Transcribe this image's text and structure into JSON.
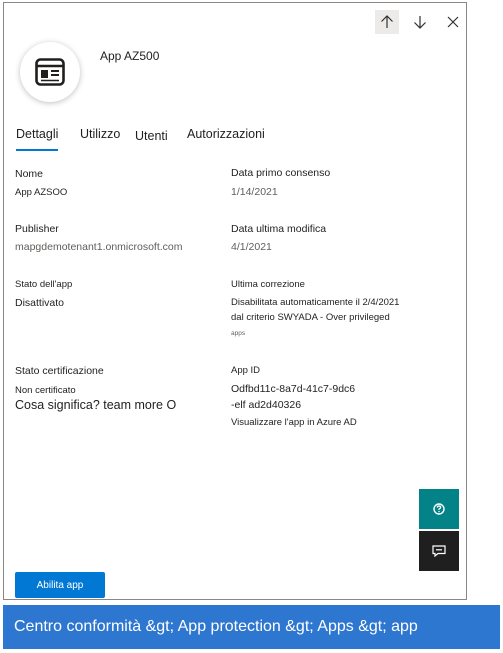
{
  "header": {
    "app_name": "App AZ500",
    "nav_up": "arrow-up-icon",
    "nav_down": "arrow-down-icon",
    "close": "close-icon"
  },
  "tabs": [
    {
      "label": "Dettagli",
      "selected": true
    },
    {
      "label": "Utilizzo",
      "selected": false
    },
    {
      "label": "Utenti",
      "selected": false
    },
    {
      "label": "Autorizzazioni",
      "selected": false
    }
  ],
  "details": {
    "name_label": "Nome",
    "name_value": "App AZSOO",
    "first_consent_label": "Data primo consenso",
    "first_consent_value": "1/14/2021",
    "publisher_label": "Publisher",
    "publisher_value": "mapgdemotenant1.onmicrosoft.com",
    "last_modified_label": "Data ultima modifica",
    "last_modified_value": "4/1/2021",
    "app_state_label": "Stato dell'app",
    "app_state_value": "Disattivato",
    "last_fix_label": "Ultima correzione",
    "last_fix_line1": "Disabilitata automaticamente il 2/4/2021",
    "last_fix_line2": "dal criterio SWYADA - Over privileged",
    "last_fix_line3": "apps",
    "cert_label": "Stato certificazione",
    "cert_value": "Non certificato",
    "cert_link": "Cosa significa? team more O",
    "app_id_label": "App ID",
    "app_id_line1": "Odfbd11c-8a7d-41c7-9dc6",
    "app_id_line2": "-elf ad2d40326",
    "azure_link": "Visualizzare l'app in Azure AD"
  },
  "side_buttons": {
    "help": "help-icon",
    "feedback": "feedback-icon",
    "help_color": "#038387",
    "feedback_color": "#1f1f1f"
  },
  "footer": {
    "enable_label": "Abilita app",
    "button_color": "#0078d4"
  },
  "caption": {
    "text": "Centro conformità &gt; App protection &gt; Apps &gt; app",
    "color": "#2e77d0"
  }
}
